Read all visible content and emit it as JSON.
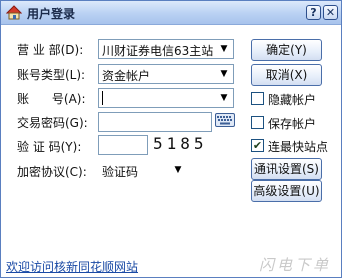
{
  "window": {
    "title": "用户登录",
    "help_glyph": "?",
    "close_glyph": "✕",
    "accent": "#b9d1f3"
  },
  "form": {
    "branch": {
      "label": "营 业 部(D):",
      "value": "川财证券电信63主站"
    },
    "account_type": {
      "label": "账号类型(L):",
      "value": "资金帐户"
    },
    "account": {
      "label": "账      号(A):",
      "value": ""
    },
    "password": {
      "label": "交易密码(G):",
      "value": ""
    },
    "captcha": {
      "label": "验 证 码(Y):",
      "value": "",
      "code": "5185"
    },
    "protocol": {
      "label": "加密协议(C):",
      "value": "验证码"
    }
  },
  "buttons": {
    "ok": "确定(Y)",
    "cancel": "取消(X)",
    "comm_settings": "通讯设置(S)",
    "advanced": "高级设置(U)"
  },
  "checkboxes": {
    "hide_account": {
      "label": "隐藏帐户",
      "checked": false
    },
    "save_account": {
      "label": "保存帐户",
      "checked": false
    },
    "fastest_site": {
      "label": "连最快站点",
      "checked": true,
      "mark": "✔"
    }
  },
  "footer": {
    "link": "欢迎访问核新同花顺网站",
    "watermark": "闪电下单"
  }
}
